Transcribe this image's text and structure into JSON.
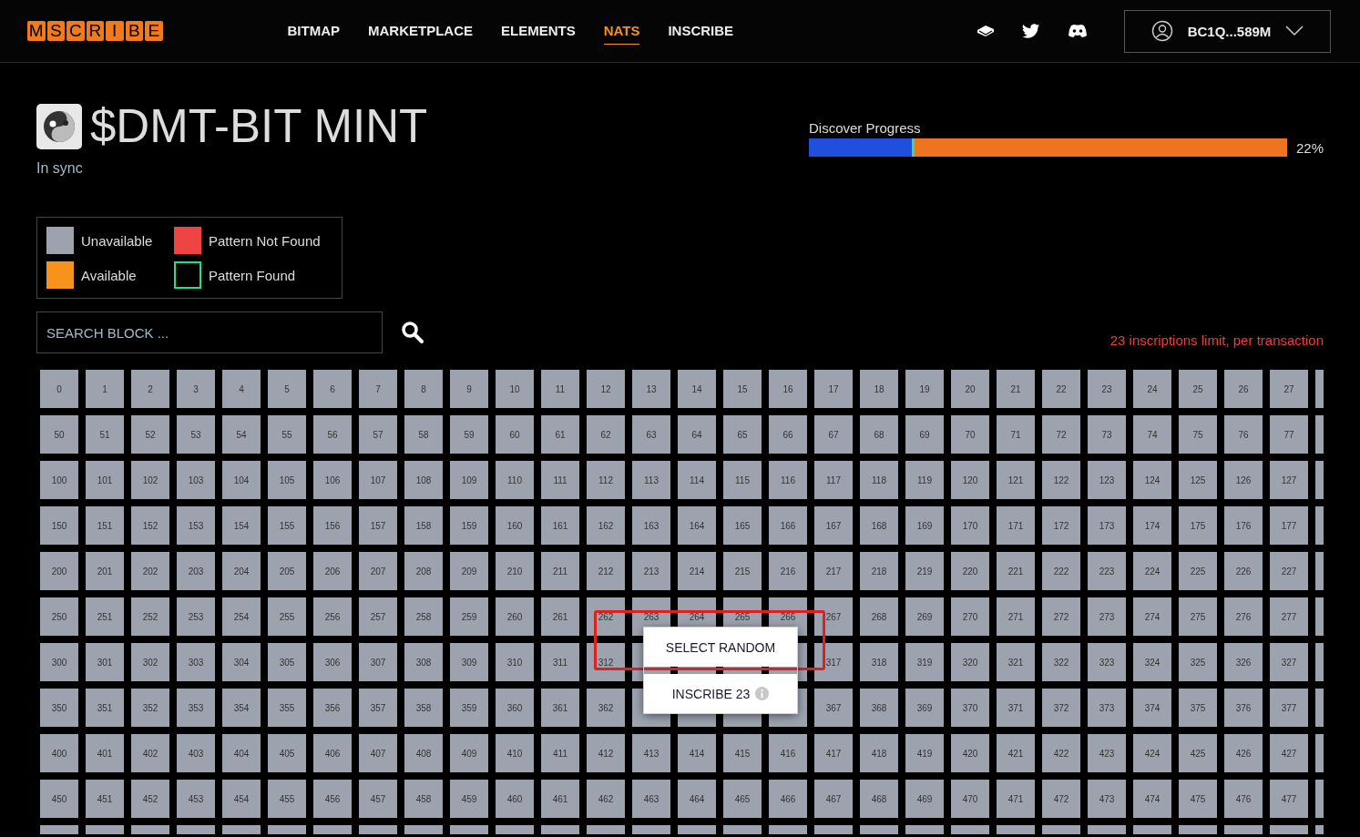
{
  "header": {
    "logo": [
      "M",
      "S",
      "C",
      "R",
      "I",
      "B",
      "E"
    ],
    "nav": [
      {
        "label": "BITMAP",
        "selected": false
      },
      {
        "label": "MARKETPLACE",
        "selected": false
      },
      {
        "label": "ELEMENTS",
        "selected": false
      },
      {
        "label": "NATS",
        "selected": true
      },
      {
        "label": "INSCRIBE",
        "selected": false
      }
    ],
    "wallet": "BC1Q...589M"
  },
  "title": "$DMT-BIT MINT",
  "sync_status": "In sync",
  "progress": {
    "label": "Discover Progress",
    "level": 0.22,
    "reading": "22%"
  },
  "legend": [
    {
      "label": "Unavailable",
      "kind": "fill",
      "color": "#9ca3af"
    },
    {
      "label": "Pattern Not Found",
      "kind": "fill",
      "color": "#ef4444"
    },
    {
      "label": "Available",
      "kind": "fill",
      "color": "#f7931a"
    },
    {
      "label": "Pattern Found",
      "kind": "outline",
      "color": "#22e08a"
    }
  ],
  "search": {
    "placeholder": "SEARCH BLOCK ..."
  },
  "limit_note": "23 inscriptions limit, per transaction",
  "grid": {
    "available": false,
    "rows": [
      [
        "0",
        "1",
        "2",
        "3",
        "4",
        "5",
        "6",
        "7",
        "8",
        "9",
        "10",
        "11",
        "12",
        "13",
        "14",
        "15",
        "16",
        "17",
        "18",
        "19",
        "20",
        "21",
        "22",
        "23",
        "24",
        "25",
        "26",
        "27"
      ],
      [
        "50",
        "51",
        "52",
        "53",
        "54",
        "55",
        "56",
        "57",
        "58",
        "59",
        "60",
        "61",
        "62",
        "63",
        "64",
        "65",
        "66",
        "67",
        "68",
        "69",
        "70",
        "71",
        "72",
        "73",
        "74",
        "75",
        "76",
        "77"
      ],
      [
        "100",
        "101",
        "102",
        "103",
        "104",
        "105",
        "106",
        "107",
        "108",
        "109",
        "110",
        "111",
        "112",
        "113",
        "114",
        "115",
        "116",
        "117",
        "118",
        "119",
        "120",
        "121",
        "122",
        "123",
        "124",
        "125",
        "126",
        "127"
      ],
      [
        "150",
        "151",
        "152",
        "153",
        "154",
        "155",
        "156",
        "157",
        "158",
        "159",
        "160",
        "161",
        "162",
        "163",
        "164",
        "165",
        "166",
        "167",
        "168",
        "169",
        "170",
        "171",
        "172",
        "173",
        "174",
        "175",
        "176",
        "177"
      ],
      [
        "200",
        "201",
        "202",
        "203",
        "204",
        "205",
        "206",
        "207",
        "208",
        "209",
        "210",
        "211",
        "212",
        "213",
        "214",
        "215",
        "216",
        "217",
        "218",
        "219",
        "220",
        "221",
        "222",
        "223",
        "224",
        "225",
        "226",
        "227"
      ],
      [
        "250",
        "251",
        "252",
        "253",
        "254",
        "255",
        "256",
        "257",
        "258",
        "259",
        "260",
        "261",
        "262",
        "263",
        "264",
        "265",
        "266",
        "267",
        "268",
        "269",
        "270",
        "271",
        "272",
        "273",
        "274",
        "275",
        "276",
        "277"
      ],
      [
        "300",
        "301",
        "302",
        "303",
        "304",
        "305",
        "306",
        "307",
        "308",
        "309",
        "310",
        "311",
        "312",
        null,
        null,
        null,
        null,
        "317",
        "318",
        "319",
        "320",
        "321",
        "322",
        "323",
        "324",
        "325",
        "326",
        "327"
      ],
      [
        "350",
        "351",
        "352",
        "353",
        "354",
        "355",
        "356",
        "357",
        "358",
        "359",
        "360",
        "361",
        "362",
        null,
        null,
        null,
        null,
        "367",
        "368",
        "369",
        "370",
        "371",
        "372",
        "373",
        "374",
        "375",
        "376",
        "377"
      ],
      [
        "400",
        "401",
        "402",
        "403",
        "404",
        "405",
        "406",
        "407",
        "408",
        "409",
        "410",
        "411",
        "412",
        "413",
        "414",
        "415",
        "416",
        "417",
        "418",
        "419",
        "420",
        "421",
        "422",
        "423",
        "424",
        "425",
        "426",
        "427"
      ],
      [
        "450",
        "451",
        "452",
        "453",
        "454",
        "455",
        "456",
        "457",
        "458",
        "459",
        "460",
        "461",
        "462",
        "463",
        "464",
        "465",
        "466",
        "467",
        "468",
        "469",
        "470",
        "471",
        "472",
        "473",
        "474",
        "475",
        "476",
        "477"
      ]
    ]
  },
  "actions": {
    "highlighted": true,
    "buttons": [
      {
        "label": "SELECT RANDOM",
        "kind": "plain"
      },
      {
        "label": "INSCRIBE 23",
        "kind": "info"
      }
    ]
  }
}
